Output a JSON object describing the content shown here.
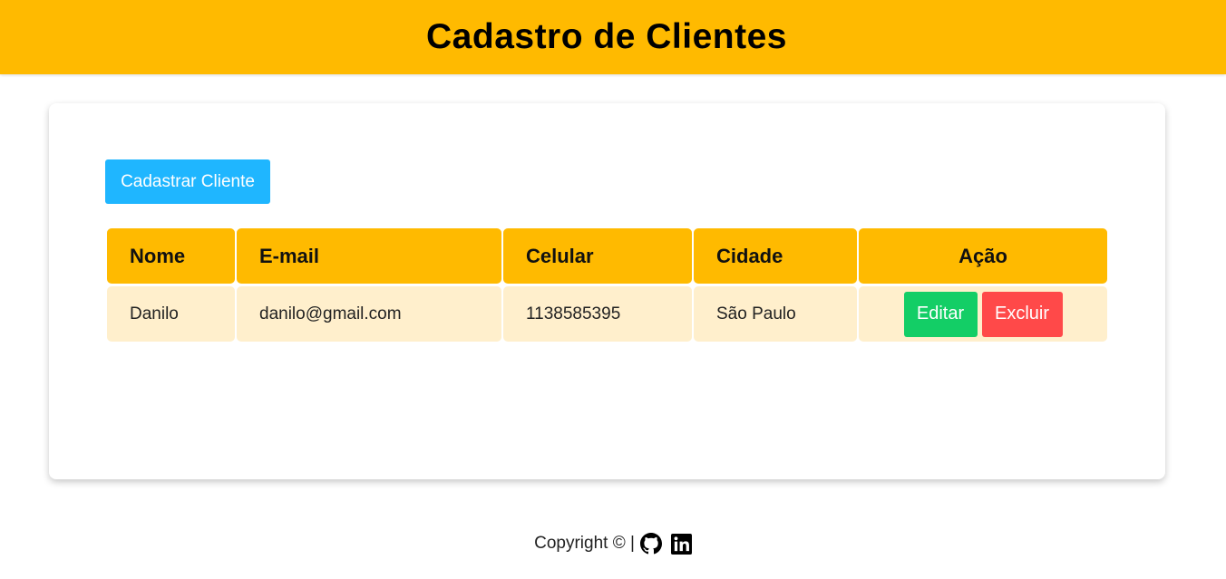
{
  "header": {
    "title": "Cadastro de Clientes"
  },
  "toolbar": {
    "add_label": "Cadastrar Cliente"
  },
  "table": {
    "columns": [
      "Nome",
      "E-mail",
      "Celular",
      "Cidade",
      "Ação"
    ],
    "rows": [
      {
        "nome": "Danilo",
        "email": "danilo@gmail.com",
        "celular": "1138585395",
        "cidade": "São Paulo",
        "edit_label": "Editar",
        "delete_label": "Excluir"
      }
    ]
  },
  "footer": {
    "copyright": "Copyright © |",
    "icons": [
      "github-icon",
      "linkedin-icon"
    ]
  },
  "colors": {
    "header_bg": "#ffba00",
    "row_bg": "#ffefcc",
    "primary_button": "#1fb6ff",
    "edit_button": "#13ce66",
    "delete_button": "#ff4949"
  }
}
